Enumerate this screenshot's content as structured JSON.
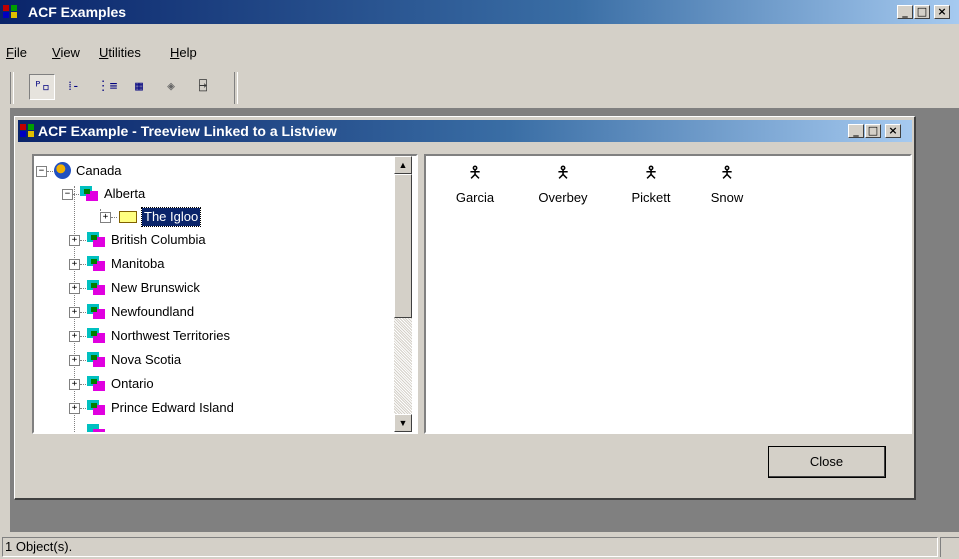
{
  "window": {
    "title": "ACF Examples"
  },
  "menu": [
    {
      "label": "File",
      "key": "F",
      "rest": "ile"
    },
    {
      "label": "View",
      "key": "V",
      "rest": "iew"
    },
    {
      "label": "Utilities",
      "key": "U",
      "rest": "tilities"
    },
    {
      "label": "Help",
      "key": "H",
      "rest": "elp"
    }
  ],
  "toolbar": {
    "buttons": [
      {
        "icon": "large-icons-icon",
        "glyph": "ᴾ▫"
      },
      {
        "icon": "small-icons-icon",
        "glyph": "⁞-"
      },
      {
        "icon": "list-view-icon",
        "glyph": "⋮≡"
      },
      {
        "icon": "details-view-icon",
        "glyph": "▦"
      },
      {
        "icon": "book-icon",
        "glyph": "◈"
      },
      {
        "icon": "exit-icon",
        "glyph": "⍈"
      }
    ]
  },
  "child_window": {
    "title": "ACF Example - Treeview Linked to a Listview"
  },
  "tree": {
    "root": "Canada",
    "items": [
      {
        "label": "Alberta",
        "expanded": true
      },
      {
        "label": "The Igloo",
        "selected": true
      },
      {
        "label": "British Columbia"
      },
      {
        "label": "Manitoba"
      },
      {
        "label": "New Brunswick"
      },
      {
        "label": "Newfoundland"
      },
      {
        "label": "Northwest Territories"
      },
      {
        "label": "Nova Scotia"
      },
      {
        "label": "Ontario"
      },
      {
        "label": "Prince Edward Island"
      }
    ]
  },
  "list": {
    "items": [
      "Garcia",
      "Overbey",
      "Pickett",
      "Snow"
    ],
    "icon": "person-icon"
  },
  "buttons": {
    "close": "Close"
  },
  "status": {
    "text": "1 Object(s)."
  }
}
